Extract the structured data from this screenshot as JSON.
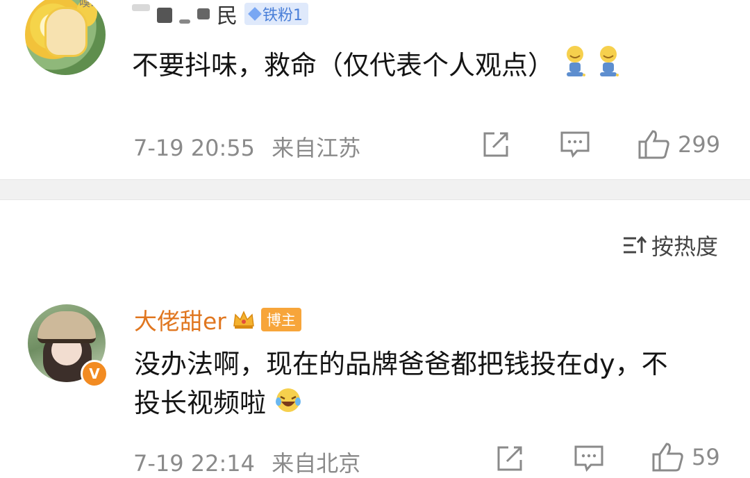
{
  "comments": [
    {
      "avatar_tag": "嗅:",
      "username_tail": "民",
      "badge": "铁粉1",
      "text": "不要抖味，救命（仅代表个人观点）",
      "time": "7-19 20:55",
      "location": "来自江苏",
      "likes": "299"
    },
    {
      "username": "大佬甜er",
      "badge": "博主",
      "verified": "V",
      "text": "没办法啊，现在的品牌爸爸都把钱投在dy，不投长视频啦",
      "time": "7-19 22:14",
      "location": "来自北京",
      "likes": "59"
    }
  ],
  "sort_label": "按热度",
  "colors": {
    "username_orange": "#e0761f",
    "meta_gray": "#8a8a8a",
    "fans_badge_blue": "#4a7fd8",
    "blogger_badge": "#f7a53a"
  },
  "icons": [
    "share-icon",
    "comment-icon",
    "like-icon",
    "sort-icon",
    "crown-icon",
    "diamond-icon"
  ]
}
